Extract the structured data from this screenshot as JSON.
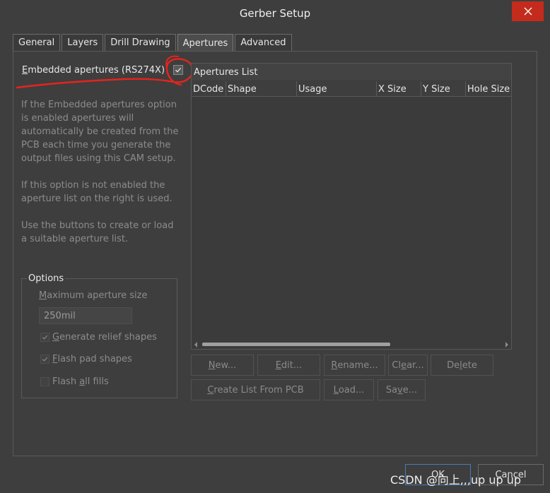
{
  "window": {
    "title": "Gerber Setup"
  },
  "tabs": [
    {
      "label": "General",
      "active": false
    },
    {
      "label": "Layers",
      "active": false
    },
    {
      "label": "Drill Drawing",
      "active": false
    },
    {
      "label": "Apertures",
      "active": true
    },
    {
      "label": "Advanced",
      "active": false
    }
  ],
  "embedded": {
    "label_accel": "E",
    "label_rest": "mbedded apertures (RS274X)",
    "checked": true
  },
  "info": {
    "p1": "If the Embedded apertures option\nis enabled apertures will\nautomatically be created from the\nPCB each time you generate the\noutput files using this CAM setup.",
    "p2": "If this option is not enabled the\naperture list on the right is used.",
    "p3": "Use the buttons to create or load\na suitable aperture list."
  },
  "options": {
    "title": "Options",
    "max_size_accel": "M",
    "max_size_rest": "aximum aperture size",
    "max_size_value": "250mil",
    "relief_accel": "G",
    "relief_rest": "enerate relief shapes",
    "relief_checked": true,
    "flash_pad_accel": "F",
    "flash_pad_rest": "lash pad shapes",
    "flash_pad_checked": true,
    "flash_all_pre": "Flash ",
    "flash_all_accel": "a",
    "flash_all_rest": "ll fills",
    "flash_all_checked": false
  },
  "apertures": {
    "title": "Apertures List",
    "columns": [
      "DCode",
      "Shape",
      "Usage",
      "X Size",
      "Y Size",
      "Hole Size"
    ]
  },
  "buttons": {
    "new": {
      "accel": "N",
      "rest": "ew..."
    },
    "edit": {
      "accel": "E",
      "rest": "dit..."
    },
    "rename": {
      "accel": "R",
      "rest": "ename..."
    },
    "clear": {
      "pre": "Cl",
      "accel": "e",
      "rest": "ar..."
    },
    "delete": {
      "pre": "De",
      "accel": "l",
      "rest": "ete"
    },
    "create": {
      "accel": "C",
      "rest": "reate List From PCB"
    },
    "load": {
      "accel": "L",
      "rest": "oad..."
    },
    "save": {
      "pre": "Sa",
      "accel": "v",
      "rest": "e..."
    },
    "ok": "OK",
    "cancel": "Cancel"
  },
  "watermark": "CSDN @向上,,,up up up",
  "colors": {
    "close": "#c42b1c",
    "annotation": "#e8231c",
    "ok_border": "#4a7ab8"
  }
}
